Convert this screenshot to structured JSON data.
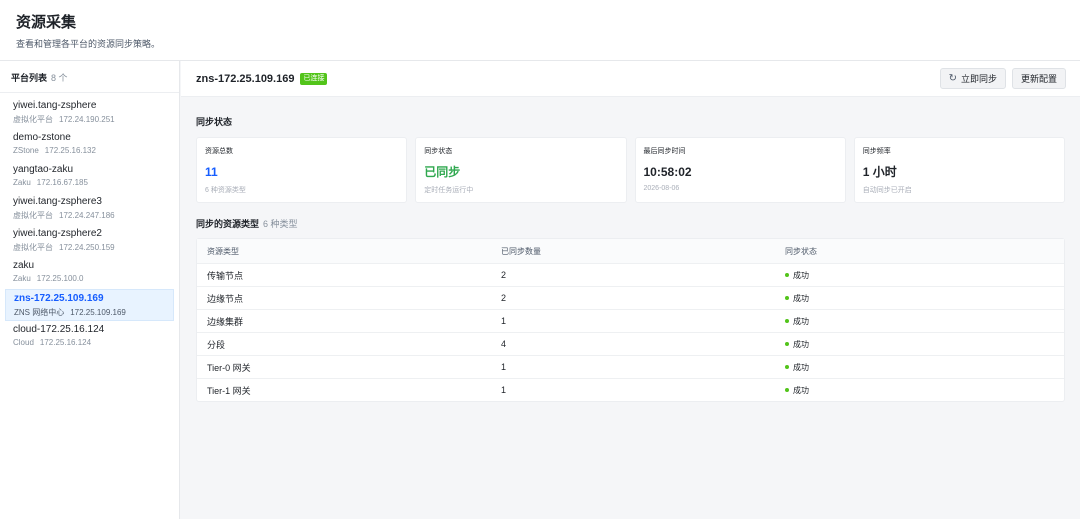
{
  "page": {
    "title": "资源采集",
    "subtitle": "查看和管理各平台的资源同步策略。"
  },
  "sidebar": {
    "title": "平台列表",
    "count": "8 个",
    "platforms": [
      {
        "name": "yiwei.tang-zsphere",
        "type": "虚拟化平台",
        "ip": "172.24.190.251"
      },
      {
        "name": "demo-zstone",
        "type": "ZStone",
        "ip": "172.25.16.132"
      },
      {
        "name": "yangtao-zaku",
        "type": "Zaku",
        "ip": "172.16.67.185"
      },
      {
        "name": "yiwei.tang-zsphere3",
        "type": "虚拟化平台",
        "ip": "172.24.247.186"
      },
      {
        "name": "yiwei.tang-zsphere2",
        "type": "虚拟化平台",
        "ip": "172.24.250.159"
      },
      {
        "name": "zaku",
        "type": "Zaku",
        "ip": "172.25.100.0"
      },
      {
        "name": "zns-172.25.109.169",
        "type": "ZNS 网络中心",
        "ip": "172.25.109.169"
      },
      {
        "name": "cloud-172.25.16.124",
        "type": "Cloud",
        "ip": "172.25.16.124"
      }
    ],
    "active_index": 6
  },
  "detail": {
    "title": "zns-172.25.109.169",
    "status_badge": "已连接",
    "sync_now_label": "立即同步",
    "sync_now_icon": "refresh-icon",
    "update_config_label": "更新配置",
    "sync_status_section": "同步状态",
    "cards": [
      {
        "label": "资源总数",
        "value": "11",
        "note": "6 种资源类型",
        "color": "#165dff"
      },
      {
        "label": "同步状态",
        "value": "已同步",
        "note": "定时任务运行中",
        "color": "#2fa84f"
      },
      {
        "label": "最后同步时间",
        "value": "10:58:02",
        "note": "2026-08-06",
        "color": "#1f2329"
      },
      {
        "label": "同步频率",
        "value": "1 小时",
        "note": "自动同步已开启",
        "color": "#1f2329"
      }
    ],
    "types_section": "同步的资源类型",
    "types_count": "6 种类型",
    "table": {
      "headers": [
        "资源类型",
        "已同步数量",
        "同步状态"
      ],
      "rows": [
        {
          "type": "传输节点",
          "count": "2",
          "status": "成功"
        },
        {
          "type": "边缘节点",
          "count": "2",
          "status": "成功"
        },
        {
          "type": "边缘集群",
          "count": "1",
          "status": "成功"
        },
        {
          "type": "分段",
          "count": "4",
          "status": "成功"
        },
        {
          "type": "Tier-0 网关",
          "count": "1",
          "status": "成功"
        },
        {
          "type": "Tier-1 网关",
          "count": "1",
          "status": "成功"
        }
      ],
      "status_color": "#52c41a"
    }
  }
}
